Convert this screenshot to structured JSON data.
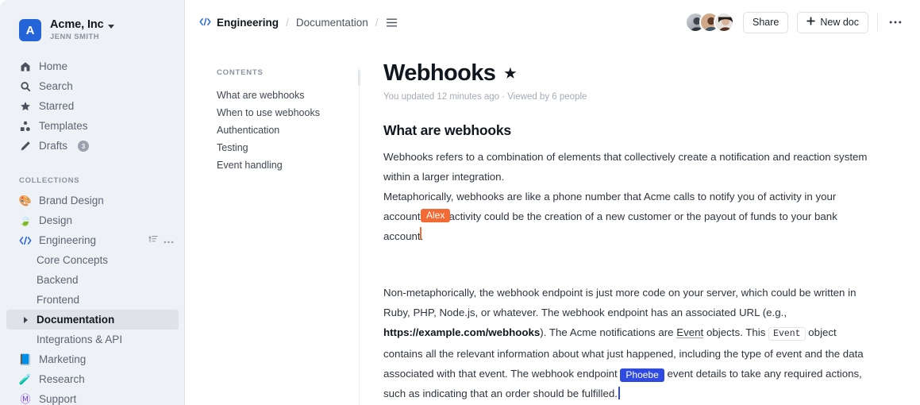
{
  "sidebar": {
    "team": {
      "logo_letter": "A",
      "name": "Acme, Inc",
      "user": "JENN SMITH"
    },
    "nav": [
      {
        "icon": "home-icon",
        "label": "Home"
      },
      {
        "icon": "search-icon",
        "label": "Search"
      },
      {
        "icon": "star-icon",
        "label": "Starred"
      },
      {
        "icon": "templates-icon",
        "label": "Templates"
      },
      {
        "icon": "pencil-icon",
        "label": "Drafts",
        "badge": "3"
      }
    ],
    "collections_label": "COLLECTIONS",
    "collections": [
      {
        "emoji": "🎨",
        "label": "Brand Design"
      },
      {
        "emoji": "🍃",
        "label": "Design"
      },
      {
        "emoji": "code",
        "label": "Engineering",
        "actions": [
          "sort-icon",
          "more-icon"
        ]
      },
      {
        "emoji": "📘",
        "label": "Marketing"
      },
      {
        "emoji": "🧪",
        "label": "Research"
      },
      {
        "emoji": "Ⓜ",
        "label": "Support"
      }
    ],
    "engineering_children": [
      {
        "label": "Core Concepts",
        "active": false
      },
      {
        "label": "Backend",
        "active": false
      },
      {
        "label": "Frontend",
        "active": false
      },
      {
        "label": "Documentation",
        "active": true
      },
      {
        "label": "Integrations & API",
        "active": false
      }
    ]
  },
  "topbar": {
    "breadcrumb": {
      "root": "Engineering",
      "child": "Documentation",
      "separator": "/"
    },
    "share_label": "Share",
    "new_doc_label": "New doc",
    "new_doc_plus": "+",
    "more_label": "•••"
  },
  "toc": {
    "label": "CONTENTS",
    "items": [
      "What are webhooks",
      "When to use webhooks",
      "Authentication",
      "Testing",
      "Event handling"
    ]
  },
  "doc": {
    "title": "Webhooks",
    "starred_glyph": "★",
    "meta": "You updated 12 minutes ago · Viewed by 6 people",
    "heading": "What are webhooks",
    "p1_a": "Webhooks refers to a combination of elements that collectively create a notification and reaction system within a larger integration.",
    "p1_b": "Metaphorically, webhooks are like a phone number that Acme calls to notify you of activity in your account. This activity could be the creation of a new customer or the payout of funds to your bank account.",
    "p2_pre": "Non-metaphorically, the webhook endpoint is just more code on your server, which could be written in Ruby, PHP, Node.js, or whatever. The webhook endpoint has an associated URL (e.g., ",
    "p2_link": "https://example.com/webhooks",
    "p2_mid": "). The Acme notifications are ",
    "p2_underline": "Event",
    "p2_mid2": " objects. This ",
    "p2_code": "Event",
    "p2_mid3": " object contains all the relevant information about what just happened, including the type of event and the data associated with that event. The webhook endpoint ",
    "p2_after_cursor": " event details to take any required actions, such as indicating that an order should be fulfilled."
  },
  "cursors": [
    {
      "name": "Alex",
      "color": "#f26a34"
    },
    {
      "name": "Phoebe",
      "color": "#2f4ae0"
    }
  ],
  "colors": {
    "sidebar_bg": "#eef1f5",
    "accent_blue": "#2563d9",
    "cursor_orange": "#f26a34",
    "cursor_blue": "#2f4ae0"
  }
}
